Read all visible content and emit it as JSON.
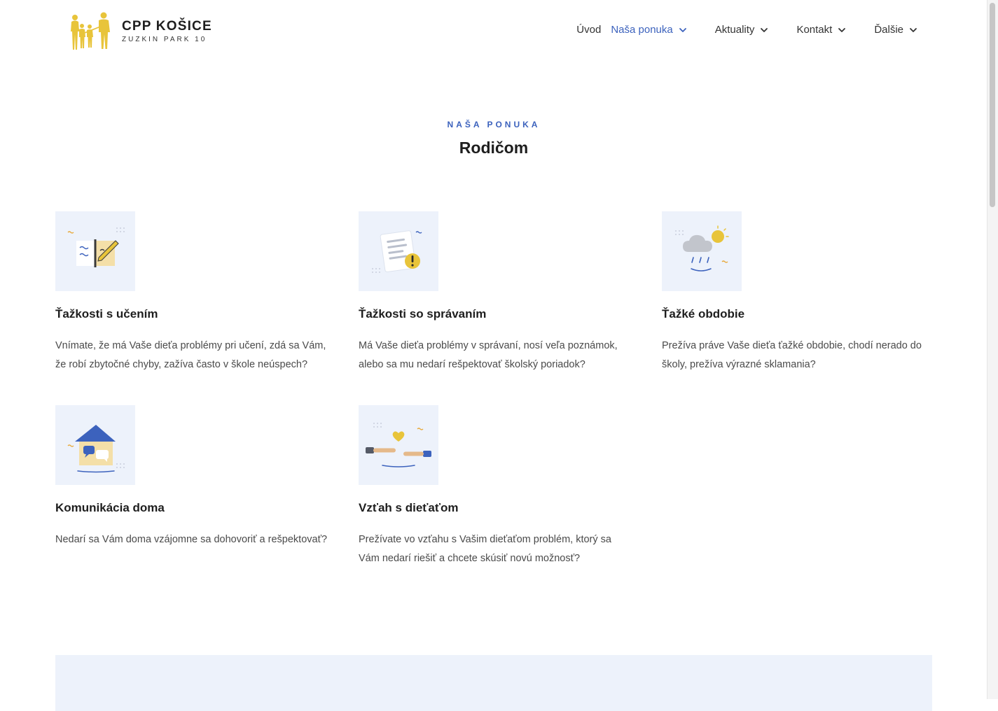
{
  "brand": {
    "title": "CPP KOŠICE",
    "subtitle": "ZUZKIN PARK 10"
  },
  "nav": {
    "items": [
      {
        "label": "Úvod",
        "has_dropdown": false
      },
      {
        "label": "Naša ponuka",
        "has_dropdown": true,
        "active": true
      },
      {
        "label": "Aktuality",
        "has_dropdown": true
      },
      {
        "label": "Kontakt",
        "has_dropdown": true
      },
      {
        "label": "Ďalšie",
        "has_dropdown": true
      }
    ]
  },
  "section": {
    "eyebrow": "NAŠA PONUKA",
    "title": "Rodičom"
  },
  "cards": [
    {
      "title": "Ťažkosti s učením",
      "text": "Vnímate, že má Vaše dieťa problémy pri učení, zdá sa Vám, že robí zbytočné chyby, zažíva často v škole neúspech?",
      "icon": "notebook-pencil-icon"
    },
    {
      "title": "Ťažkosti so správaním",
      "text": "Má Vaše dieťa problémy v správaní, nosí veľa poznámok, alebo sa mu nedarí rešpektovať školský poriadok?",
      "icon": "warning-note-icon"
    },
    {
      "title": "Ťažké obdobie",
      "text": "Prežíva práve Vaše dieťa ťažké obdobie, chodí nerado do školy, prežíva výrazné sklamania?",
      "icon": "rain-cloud-icon"
    },
    {
      "title": "Komunikácia doma",
      "text": "Nedarí sa Vám doma vzájomne sa dohovoriť a rešpektovať?",
      "icon": "house-chat-icon"
    },
    {
      "title": "Vzťah s dieťaťom",
      "text": "Prežívate vo vzťahu s Vašim dieťaťom problém, ktorý sa Vám nedarí riešiť a chcete skúsiť novú možnosť?",
      "icon": "handshake-heart-icon"
    }
  ],
  "colors": {
    "accent": "#3c62bd",
    "logo_yellow": "#e8c43a",
    "card_bg": "#edf2fb"
  }
}
